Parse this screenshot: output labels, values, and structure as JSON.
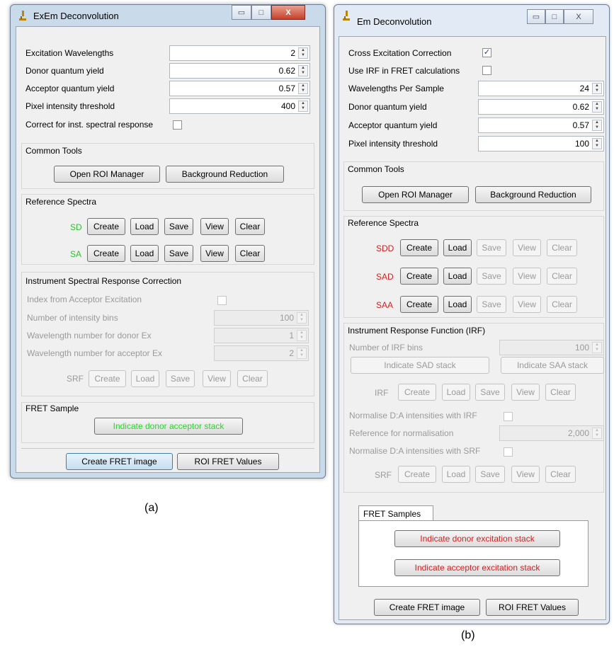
{
  "window_a": {
    "title": "ExEm Deconvolution",
    "ctrl_min": "▭",
    "ctrl_max": "□",
    "ctrl_close": "X",
    "fields": [
      {
        "label": "Excitation Wavelengths",
        "value": "2"
      },
      {
        "label": "Donor quantum yield",
        "value": "0.62"
      },
      {
        "label": "Acceptor quantum yield",
        "value": "0.57"
      },
      {
        "label": "Pixel intensity threshold",
        "value": "400"
      }
    ],
    "correct_label": "Correct for inst. spectral response",
    "correct_checked": "",
    "common_tools": {
      "title": "Common Tools",
      "roi_button": "Open ROI Manager",
      "bg_button": "Background Reduction"
    },
    "reference": {
      "title": "Reference Spectra",
      "rows": [
        {
          "label": "SD",
          "color": "#2fbf2f",
          "create": "Create",
          "load": "Load",
          "save": "Save",
          "view": "View",
          "clear": "Clear"
        },
        {
          "label": "SA",
          "color": "#2fbf2f",
          "create": "Create",
          "load": "Load",
          "save": "Save",
          "view": "View",
          "clear": "Clear"
        }
      ]
    },
    "isrc": {
      "title": "Instrument Spectral Response Correction",
      "index_label": "Index from Acceptor Excitation",
      "fields": [
        {
          "label": "Number of intensity bins",
          "value": "100"
        },
        {
          "label": "Wavelength number for donor Ex",
          "value": "1"
        },
        {
          "label": "Wavelength number for acceptor Ex",
          "value": "2"
        }
      ],
      "srf": {
        "label": "SRF",
        "create": "Create",
        "load": "Load",
        "save": "Save",
        "view": "View",
        "clear": "Clear"
      }
    },
    "fret": {
      "title": "FRET Sample",
      "button": "Indicate donor acceptor stack",
      "button_color": "#2fd12f"
    },
    "bottom": {
      "create": "Create FRET image",
      "roi": "ROI FRET Values"
    }
  },
  "window_b": {
    "title": "Em Deconvolution",
    "ctrl_min": "▭",
    "ctrl_max": "□",
    "ctrl_close": "X",
    "cross_label": "Cross Excitation Correction",
    "cross_checked": "✓",
    "irf_label": "Use IRF in FRET calculations",
    "irf_checked": "",
    "fields": [
      {
        "label": "Wavelengths Per Sample",
        "value": "24"
      },
      {
        "label": "Donor quantum yield",
        "value": "0.62"
      },
      {
        "label": "Acceptor quantum yield",
        "value": "0.57"
      },
      {
        "label": "Pixel intensity threshold",
        "value": "100"
      }
    ],
    "common_tools": {
      "title": "Common Tools",
      "roi_button": "Open ROI Manager",
      "bg_button": "Background Reduction"
    },
    "reference": {
      "title": "Reference Spectra",
      "rows": [
        {
          "label": "SDD",
          "color": "#d42020",
          "create": "Create",
          "load": "Load",
          "save": "Save",
          "view": "View",
          "clear": "Clear"
        },
        {
          "label": "SAD",
          "color": "#d42020",
          "create": "Create",
          "load": "Load",
          "save": "Save",
          "view": "View",
          "clear": "Clear"
        },
        {
          "label": "SAA",
          "color": "#d42020",
          "create": "Create",
          "load": "Load",
          "save": "Save",
          "view": "View",
          "clear": "Clear"
        }
      ]
    },
    "irf_section": {
      "title": "Instrument Response Function (IRF)",
      "bins_label": "Number of IRF bins",
      "bins_value": "100",
      "sad_button": "Indicate SAD stack",
      "saa_button": "Indicate SAA stack",
      "irf_row": {
        "label": "IRF",
        "create": "Create",
        "load": "Load",
        "save": "Save",
        "view": "View",
        "clear": "Clear"
      },
      "norm_irf_label": "Normalise D:A intensities with IRF",
      "ref_norm_label": "Reference for normalisation",
      "ref_norm_value": "2,000",
      "norm_srf_label": "Normalise D:A intensities with SRF",
      "srf_row": {
        "label": "SRF",
        "create": "Create",
        "load": "Load",
        "save": "Save",
        "view": "View",
        "clear": "Clear"
      }
    },
    "fret": {
      "tab": "FRET Samples",
      "donor_button": "Indicate donor excitation stack",
      "acceptor_button": "Indicate acceptor excitation stack",
      "button_color": "#d42020"
    },
    "bottom": {
      "create": "Create FRET image",
      "roi": "ROI FRET Values"
    }
  },
  "captions": {
    "a": "(a)",
    "b": "(b)"
  }
}
